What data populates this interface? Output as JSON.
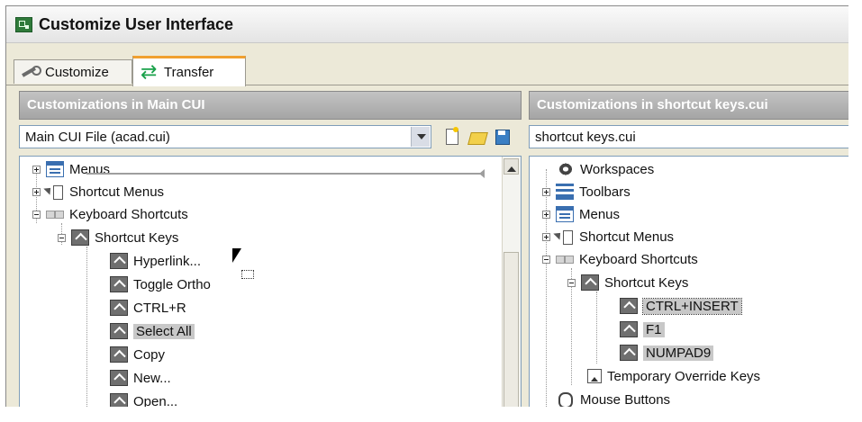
{
  "window": {
    "title": "Customize User Interface"
  },
  "tabs": [
    {
      "label": "Customize",
      "icon": "wrench-icon",
      "active": false
    },
    {
      "label": "Transfer",
      "icon": "transfer-arrows-icon",
      "active": true
    }
  ],
  "left_panel": {
    "header": "Customizations in Main CUI",
    "file_select": {
      "value": "Main CUI File (acad.cui)"
    },
    "tree": [
      {
        "label": "Menus",
        "icon": "menu-icon",
        "expander": "plus"
      },
      {
        "label": "Shortcut Menus",
        "icon": "shortcut-menu-icon",
        "expander": "plus"
      },
      {
        "label": "Keyboard Shortcuts",
        "icon": "keyboard-icon",
        "expander": "minus"
      },
      {
        "label": "Shortcut Keys",
        "icon": "shortcut-key-icon",
        "expander": "minus"
      },
      {
        "label": "Hyperlink...",
        "icon": "shortcut-key-icon"
      },
      {
        "label": "Toggle Ortho",
        "icon": "shortcut-key-icon"
      },
      {
        "label": "CTRL+R",
        "icon": "shortcut-key-icon"
      },
      {
        "label": "Select All",
        "icon": "shortcut-key-icon",
        "selected": true
      },
      {
        "label": "Copy",
        "icon": "shortcut-key-icon"
      },
      {
        "label": "New...",
        "icon": "shortcut-key-icon"
      },
      {
        "label": "Open...",
        "icon": "shortcut-key-icon"
      }
    ]
  },
  "right_panel": {
    "header": "Customizations in shortcut keys.cui",
    "file_select": {
      "value": "shortcut keys.cui"
    },
    "tree": [
      {
        "label": "Workspaces",
        "icon": "workspace-icon"
      },
      {
        "label": "Toolbars",
        "icon": "toolbar-icon",
        "expander": "plus"
      },
      {
        "label": "Menus",
        "icon": "menu-icon",
        "expander": "plus"
      },
      {
        "label": "Shortcut Menus",
        "icon": "shortcut-menu-icon",
        "expander": "plus"
      },
      {
        "label": "Keyboard Shortcuts",
        "icon": "keyboard-icon",
        "expander": "minus"
      },
      {
        "label": "Shortcut Keys",
        "icon": "shortcut-key-icon",
        "expander": "minus"
      },
      {
        "label": "CTRL+INSERT",
        "icon": "shortcut-key-icon",
        "selected": true
      },
      {
        "label": "F1",
        "icon": "shortcut-key-icon",
        "selected": true
      },
      {
        "label": "NUMPAD9",
        "icon": "shortcut-key-icon",
        "selected": true
      },
      {
        "label": "Temporary Override Keys",
        "icon": "override-key-icon"
      },
      {
        "label": "Mouse Buttons",
        "icon": "mouse-icon"
      }
    ]
  },
  "colors": {
    "accent_tab": "#f0a030",
    "panel_header": "#a5a5a5",
    "selection": "#c8c8c8"
  }
}
